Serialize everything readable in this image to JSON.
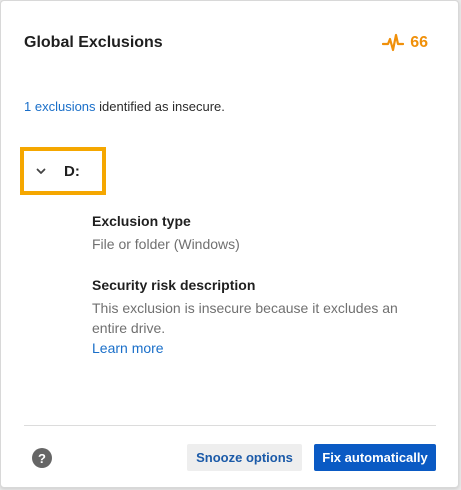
{
  "header": {
    "title": "Global Exclusions",
    "score": "66",
    "score_icon": "pulse-icon",
    "score_color": "#f0900a"
  },
  "summary": {
    "link_text": "1 exclusions",
    "rest_text": " identified as insecure."
  },
  "exclusion": {
    "drive": "D:",
    "expand_icon": "chevron-down-icon",
    "highlight_color": "#f5a700",
    "type_label": "Exclusion type",
    "type_value": "File or folder (Windows)",
    "risk_label": "Security risk description",
    "risk_text": "This exclusion is insecure because it excludes an entire drive.",
    "learn_more": "Learn more"
  },
  "footer": {
    "help_icon": "question-circle-icon",
    "help_glyph": "?",
    "snooze_label": "Snooze options",
    "fix_label": "Fix automatically",
    "primary_color": "#0a5ac4"
  }
}
